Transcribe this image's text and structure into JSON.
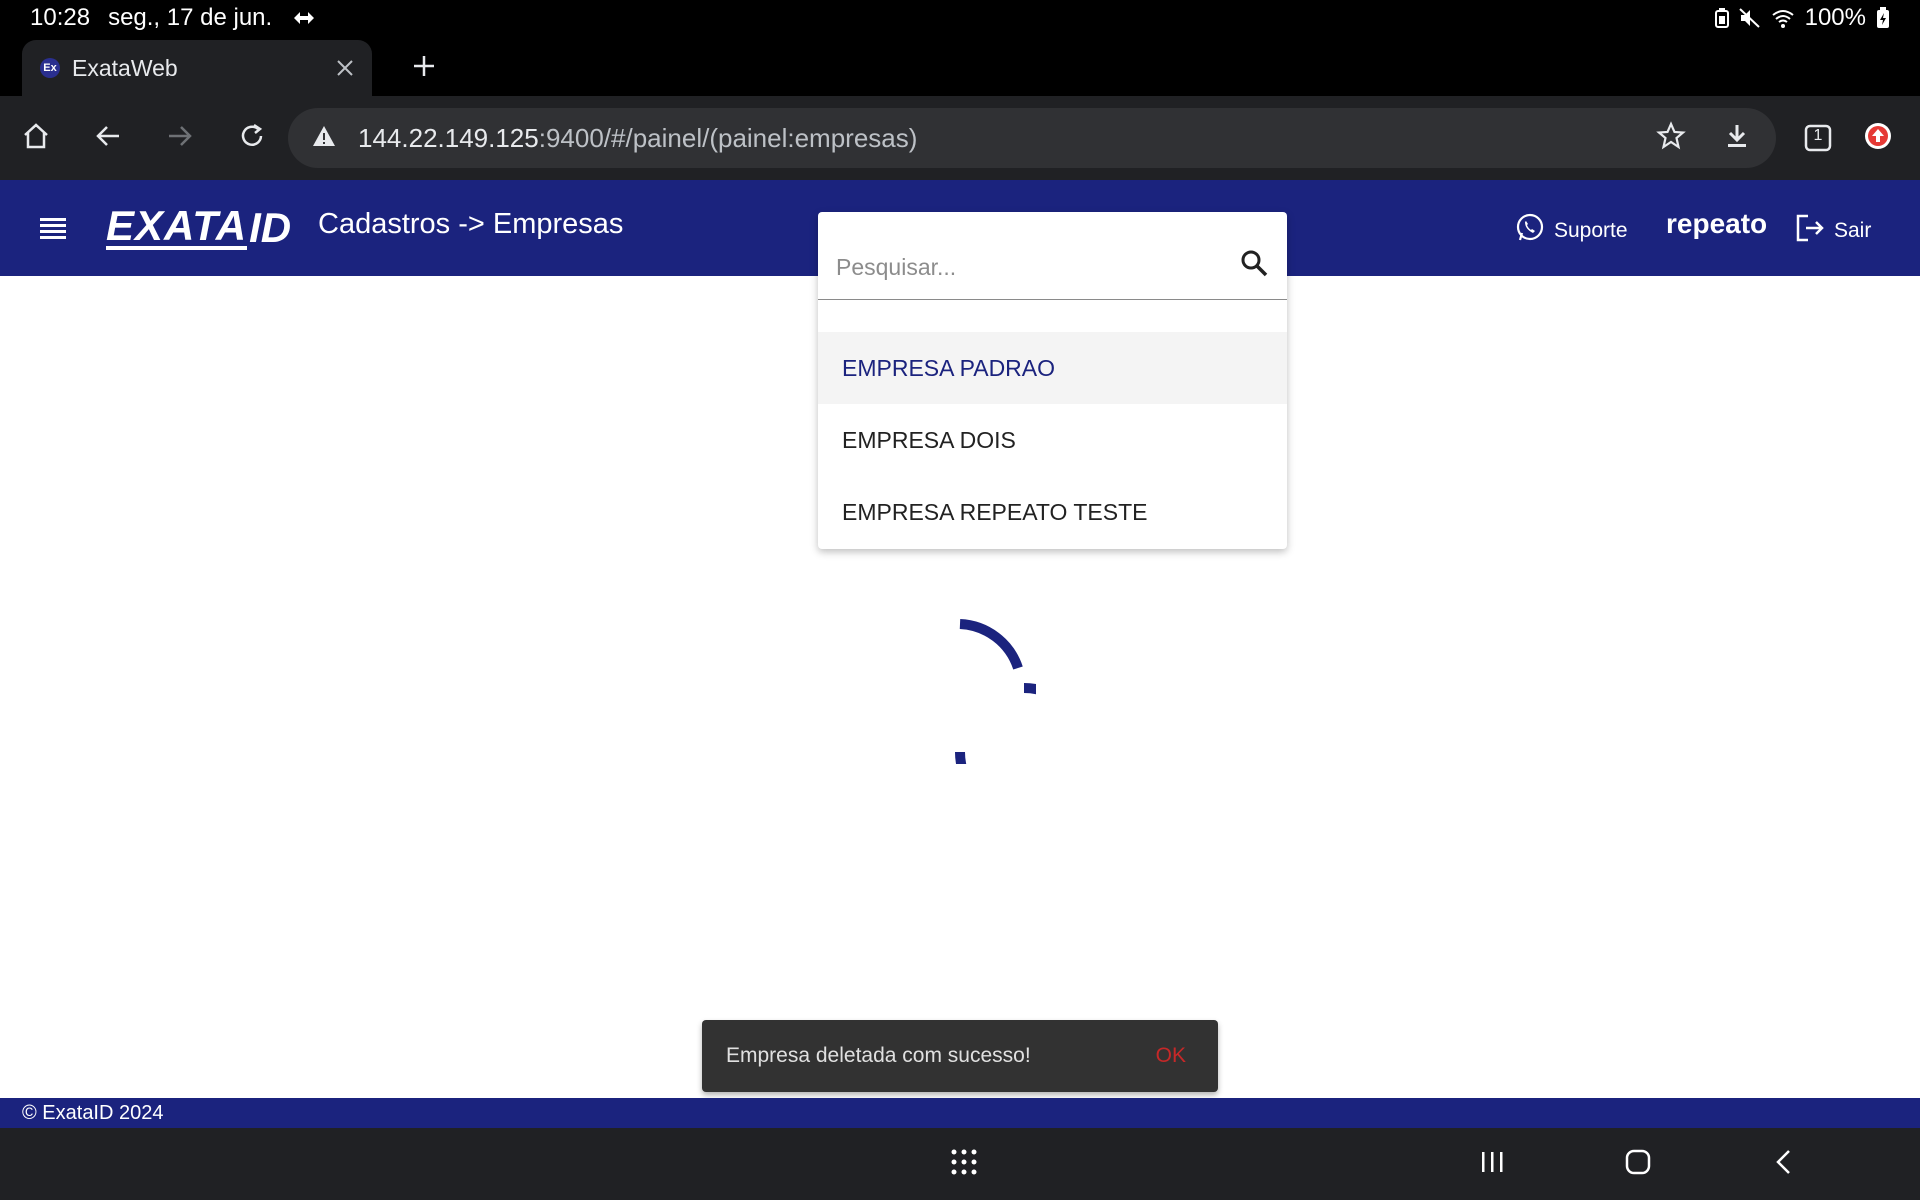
{
  "status_bar": {
    "time": "10:28",
    "date": "seg., 17 de jun.",
    "battery": "100%",
    "icons": [
      "diamond-nav-icon",
      "battery-saver-icon",
      "mute-icon",
      "wifi-icon",
      "battery-icon"
    ]
  },
  "browser": {
    "tab_title": "ExataWeb",
    "favicon_text": "Ex",
    "url_host": "144.22.149.125",
    "url_path": ":9400/#/painel/(painel:empresas)",
    "tab_count": "1"
  },
  "header": {
    "logo_main": "EXATA",
    "logo_suffix": "ID",
    "title": "Cadastros -> Empresas",
    "support_label": "Suporte",
    "user_name": "repeato",
    "logout_label": "Sair"
  },
  "search": {
    "placeholder": "Pesquisar...",
    "options": [
      {
        "label": "EMPRESA PADRAO"
      },
      {
        "label": "EMPRESA DOIS"
      },
      {
        "label": "EMPRESA REPEATO TESTE"
      }
    ]
  },
  "snackbar": {
    "message": "Empresa deletada com sucesso!",
    "action": "OK"
  },
  "footer": {
    "copyright": "© ExataID 2024"
  },
  "colors": {
    "brand": "#1b237e",
    "snackbar_action": "#c62828"
  }
}
